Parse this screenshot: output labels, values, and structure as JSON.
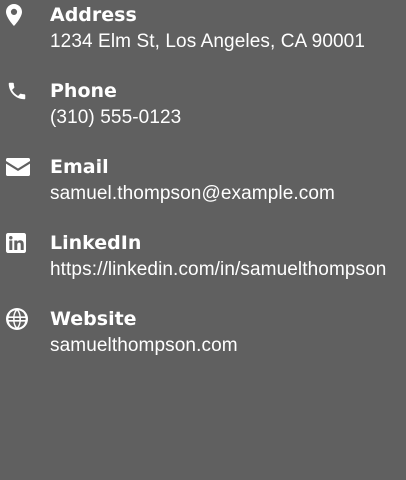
{
  "contacts": [
    {
      "icon": "map-marker-icon",
      "label": "Address",
      "value": "1234 Elm St, Los Angeles, CA 90001"
    },
    {
      "icon": "phone-icon",
      "label": "Phone",
      "value": "(310) 555-0123"
    },
    {
      "icon": "envelope-icon",
      "label": "Email",
      "value": "samuel.thompson@example.com"
    },
    {
      "icon": "linkedin-icon",
      "label": "LinkedIn",
      "value": "https://linkedin.com/in/samuelthompson"
    },
    {
      "icon": "globe-icon",
      "label": "Website",
      "value": "samuelthompson.com"
    }
  ],
  "colors": {
    "background": "#606060",
    "text": "#ffffff"
  }
}
